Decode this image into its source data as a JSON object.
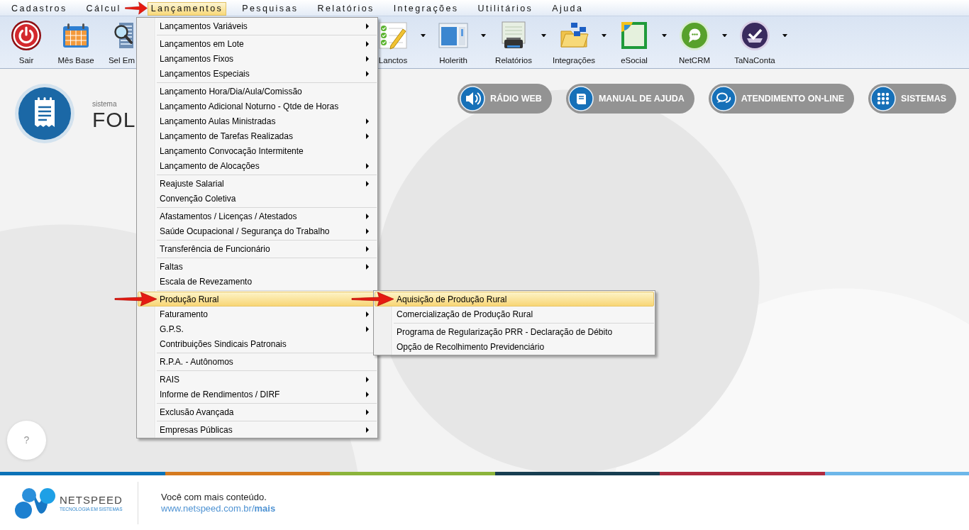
{
  "menu_bar": {
    "items": [
      {
        "label": "Cadastros",
        "selected": false
      },
      {
        "label": "Cálcul",
        "selected": false
      },
      {
        "label": "Lançamentos",
        "selected": true
      },
      {
        "label": "Pesquisas",
        "selected": false
      },
      {
        "label": "Relatórios",
        "selected": false
      },
      {
        "label": "Integrações",
        "selected": false
      },
      {
        "label": "Utilitários",
        "selected": false
      },
      {
        "label": "Ajuda",
        "selected": false
      }
    ]
  },
  "toolbar": {
    "buttons": [
      {
        "label": "Sair",
        "dropdown": false
      },
      {
        "label": "Mês Base",
        "dropdown": false
      },
      {
        "label": "Sel Em",
        "dropdown": false
      },
      {
        "label": "Lanctos",
        "dropdown": true
      },
      {
        "label": "Holerith",
        "dropdown": true
      },
      {
        "label": "Relatórios",
        "dropdown": true
      },
      {
        "label": "Integrações",
        "dropdown": true
      },
      {
        "label": "eSocial",
        "dropdown": true
      },
      {
        "label": "NetCRM",
        "dropdown": true
      },
      {
        "label": "TaNaConta",
        "dropdown": true
      }
    ]
  },
  "dropdown_menu": {
    "groups": [
      {
        "items": [
          {
            "label": "Lançamentos Variáveis",
            "submenu": true,
            "selected": false
          }
        ]
      },
      {
        "items": [
          {
            "label": "Lançamentos em Lote",
            "submenu": true,
            "selected": false
          },
          {
            "label": "Lançamentos Fixos",
            "submenu": true,
            "selected": false
          },
          {
            "label": "Lançamentos Especiais",
            "submenu": true,
            "selected": false
          }
        ]
      },
      {
        "items": [
          {
            "label": "Lançamento Hora/Dia/Aula/Comissão",
            "submenu": false,
            "selected": false
          },
          {
            "label": "Lançamento Adicional Noturno - Qtde de Horas",
            "submenu": false,
            "selected": false
          },
          {
            "label": "Lançamento Aulas Ministradas",
            "submenu": true,
            "selected": false
          },
          {
            "label": "Lançamento de Tarefas Realizadas",
            "submenu": true,
            "selected": false
          },
          {
            "label": "Lançamento Convocação Intermitente",
            "submenu": false,
            "selected": false
          },
          {
            "label": "Lançamento de Alocações",
            "submenu": true,
            "selected": false
          }
        ]
      },
      {
        "items": [
          {
            "label": "Reajuste Salarial",
            "submenu": true,
            "selected": false
          },
          {
            "label": "Convenção Coletiva",
            "submenu": false,
            "selected": false
          }
        ]
      },
      {
        "items": [
          {
            "label": "Afastamentos / Licenças / Atestados",
            "submenu": true,
            "selected": false
          },
          {
            "label": "Saúde Ocupacional / Segurança do Trabalho",
            "submenu": true,
            "selected": false
          }
        ]
      },
      {
        "items": [
          {
            "label": "Transferência de Funcionário",
            "submenu": true,
            "selected": false
          }
        ]
      },
      {
        "items": [
          {
            "label": "Faltas",
            "submenu": true,
            "selected": false
          },
          {
            "label": "Escala de Revezamento",
            "submenu": false,
            "selected": false
          }
        ]
      },
      {
        "items": [
          {
            "label": "Produção Rural",
            "submenu": false,
            "selected": true
          },
          {
            "label": "Faturamento",
            "submenu": true,
            "selected": false
          },
          {
            "label": "G.P.S.",
            "submenu": true,
            "selected": false
          },
          {
            "label": "Contribuições Sindicais Patronais",
            "submenu": false,
            "selected": false
          }
        ]
      },
      {
        "items": [
          {
            "label": "R.P.A. - Autônomos",
            "submenu": false,
            "selected": false
          }
        ]
      },
      {
        "items": [
          {
            "label": "RAIS",
            "submenu": true,
            "selected": false
          },
          {
            "label": "Informe de Rendimentos / DIRF",
            "submenu": true,
            "selected": false
          }
        ]
      },
      {
        "items": [
          {
            "label": "Exclusão Avançada",
            "submenu": true,
            "selected": false
          }
        ]
      },
      {
        "items": [
          {
            "label": "Empresas Públicas",
            "submenu": true,
            "selected": false
          }
        ]
      }
    ]
  },
  "submenu": {
    "groups": [
      {
        "items": [
          {
            "label": "Aquisição de Produção Rural",
            "selected": true
          },
          {
            "label": "Comercialização de Produção Rural",
            "selected": false
          }
        ]
      },
      {
        "items": [
          {
            "label": "Programa de Regularização PRR - Declaração de Débito",
            "selected": false
          },
          {
            "label": "Opção de Recolhimento Previdenciário",
            "selected": false
          }
        ]
      }
    ]
  },
  "brand": {
    "caption": "sistema",
    "name": "FOL"
  },
  "quick_links": [
    {
      "label": "RÁDIO WEB"
    },
    {
      "label": "MANUAL DE AJUDA"
    },
    {
      "label": "ATENDIMENTO ON-LINE"
    },
    {
      "label": "SISTEMAS"
    }
  ],
  "help_button": {
    "label": "?"
  },
  "footer": {
    "logo_name": "NETSPEED",
    "logo_tagline": "TECNOLOGIA EM SISTEMAS",
    "tagline": "Você com mais conteúdo.",
    "link": "www.netspeed.com.br/**mais**"
  }
}
